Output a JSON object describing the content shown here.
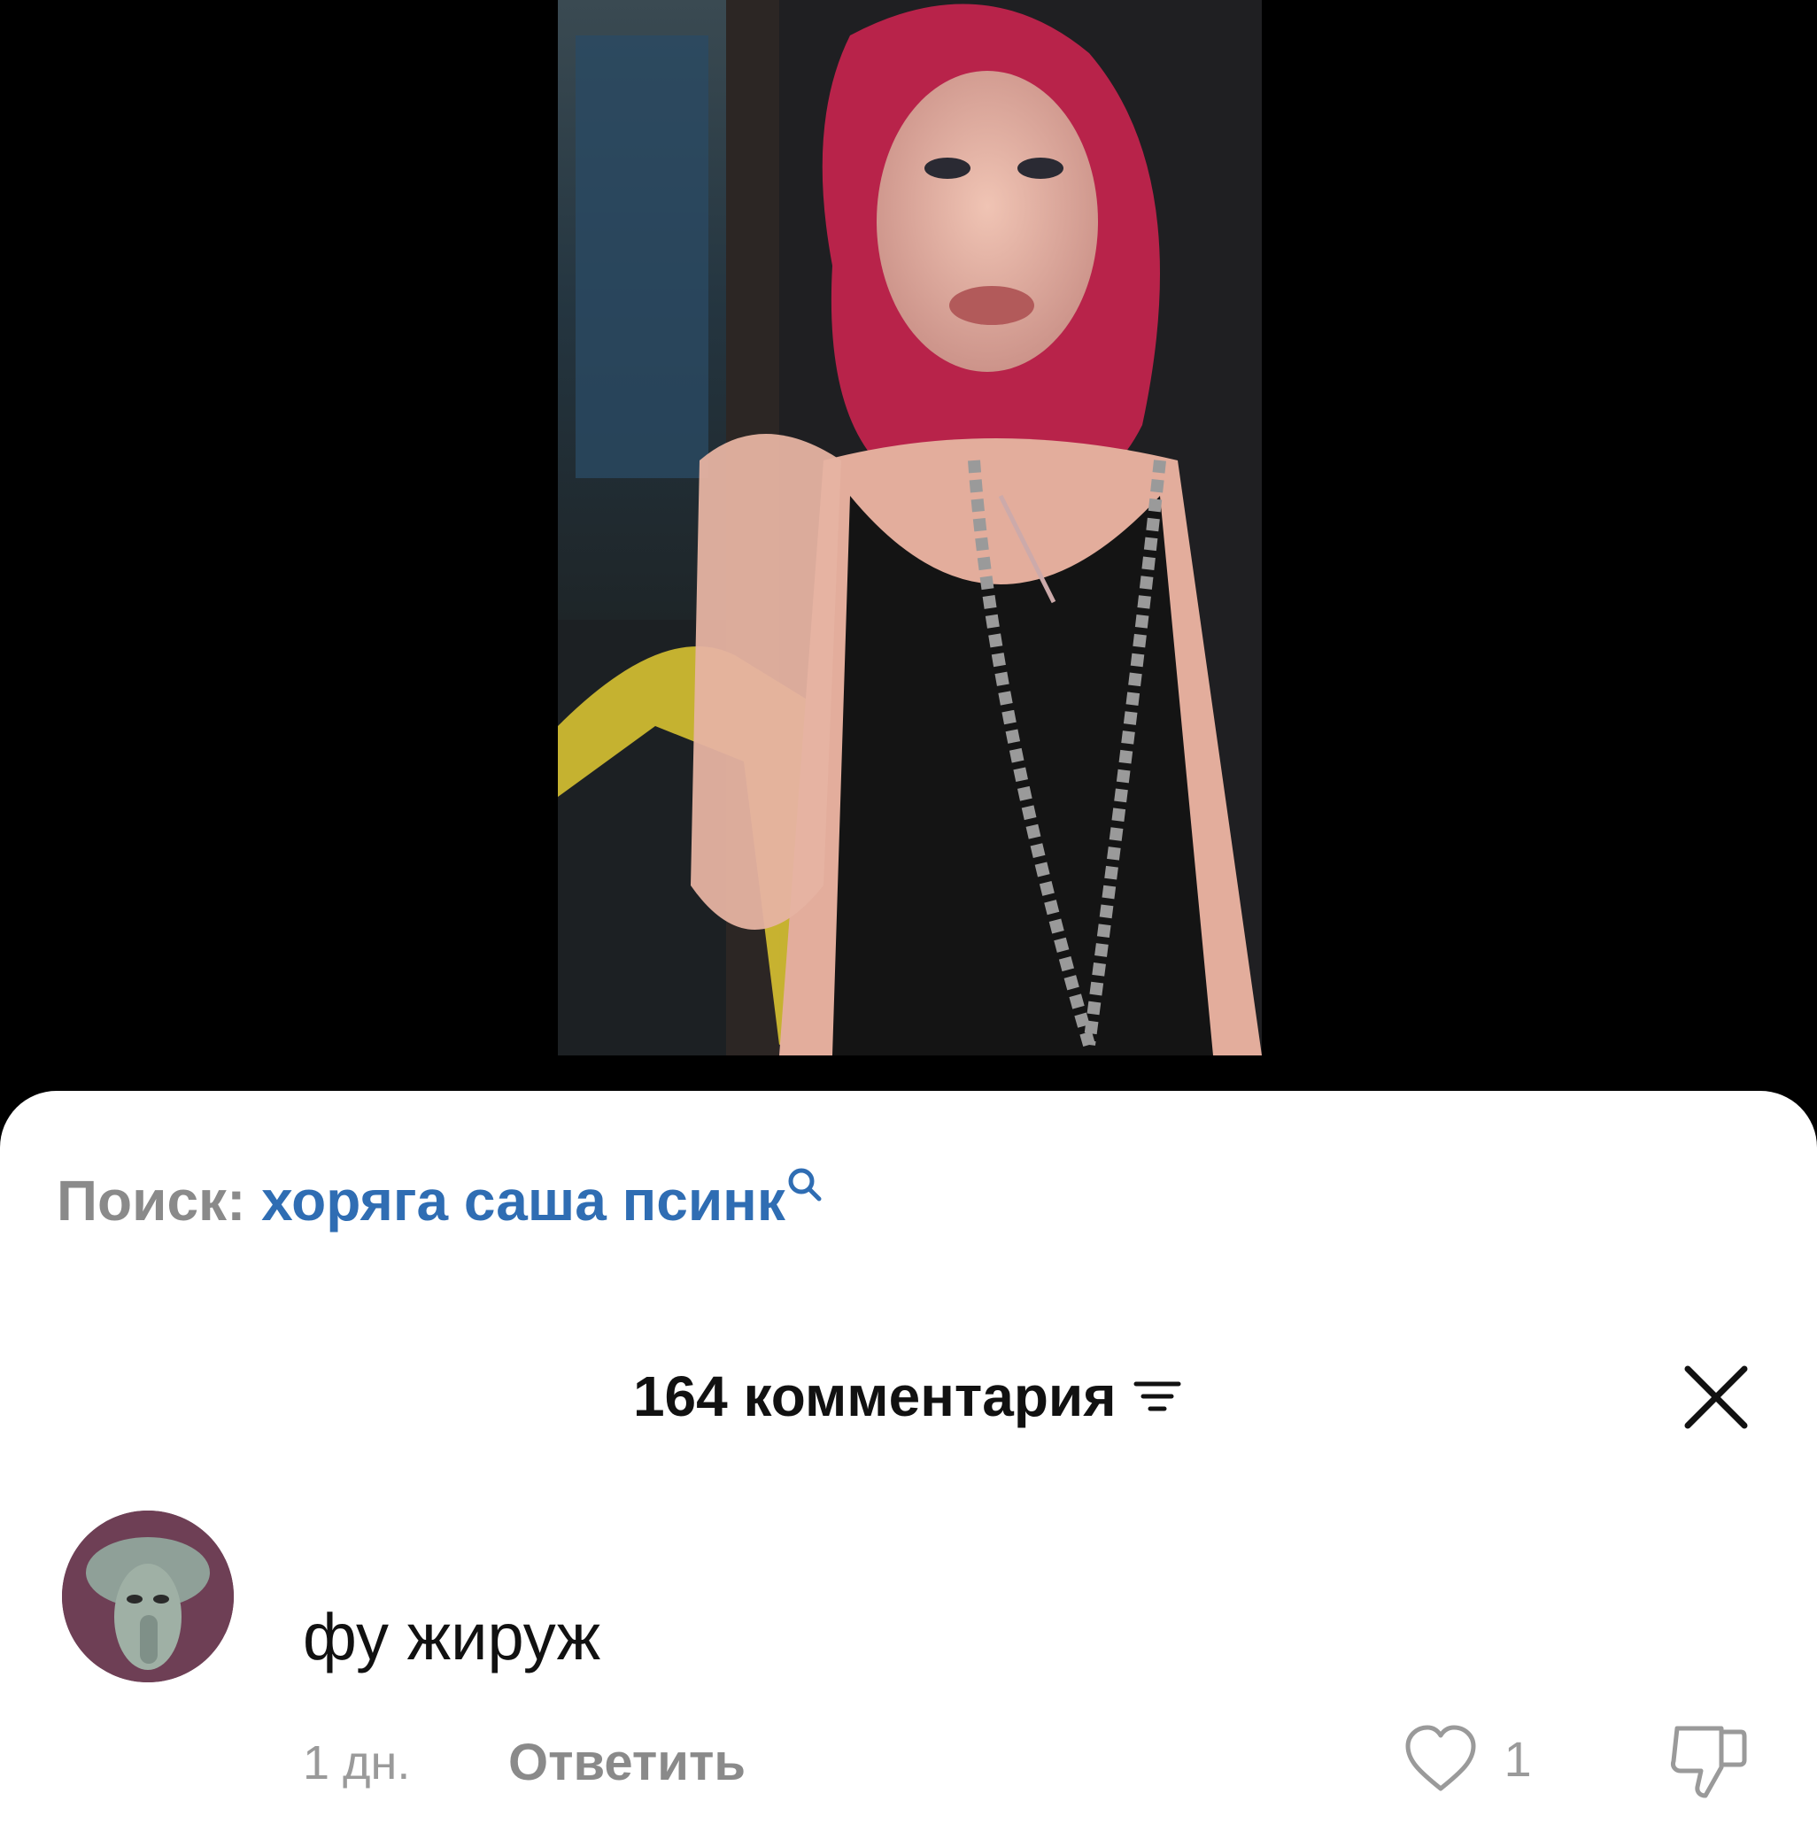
{
  "search": {
    "prefix": "Поиск:",
    "query": "хоряга саша псинк",
    "icon": "search-icon"
  },
  "comments_header": {
    "title": "164 комментария",
    "sort_icon": "sort-filter-icon",
    "close_icon": "close-icon"
  },
  "comment": {
    "text": "фу жируж",
    "time": "1 дн.",
    "reply_label": "Ответить",
    "like_count": "1",
    "like_icon": "heart-outline-icon",
    "dislike_icon": "thumbs-down-icon"
  },
  "colors": {
    "accent": "#2f6db3",
    "muted": "#8a8a8a",
    "text": "#111111",
    "background_video": "#000000",
    "sheet": "#ffffff"
  }
}
